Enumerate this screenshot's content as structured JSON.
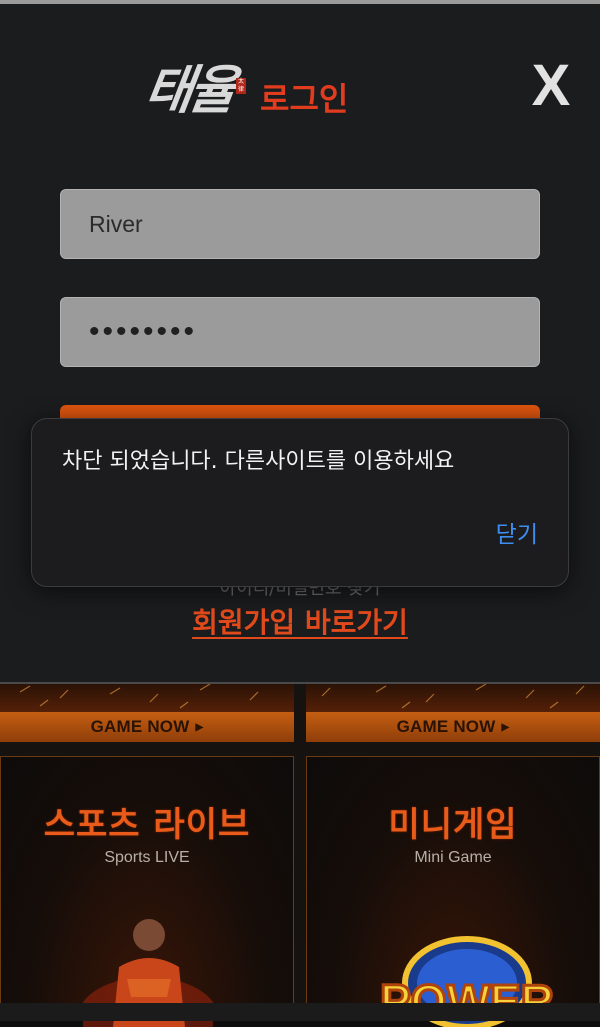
{
  "login": {
    "logo_script": "태율",
    "logo_seal": "太律",
    "title": "로그인",
    "close_label": "X",
    "username_value": "River",
    "password_value": "••••••••",
    "help_text": "아이디/비밀번호 찾기",
    "signup_label": "회원가입 바로가기"
  },
  "alert": {
    "message": "차단 되었습니다. 다른사이트를 이용하세요",
    "close_label": "닫기"
  },
  "games": {
    "items": [
      {
        "banner_label": "GAME NOW",
        "title": "스포츠 라이브",
        "subtitle": "Sports LIVE"
      },
      {
        "banner_label": "GAME NOW",
        "title": "미니게임",
        "subtitle": "Mini Game",
        "logo_text": "POWER"
      }
    ]
  },
  "colors": {
    "accent": "#e0560f",
    "title_red": "#e23c1f",
    "link_blue": "#3d8ef0",
    "panel_bg": "#1b1c1e"
  }
}
